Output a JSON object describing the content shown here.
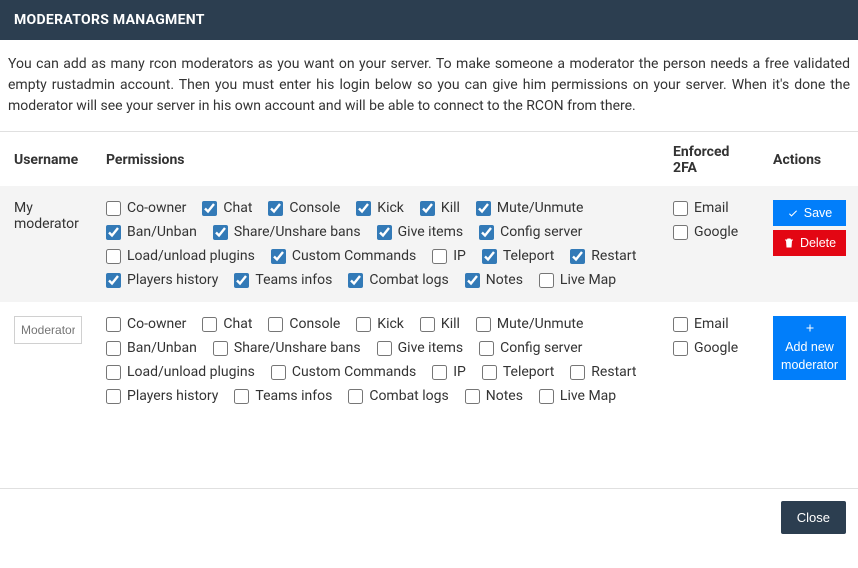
{
  "header": {
    "title": "MODERATORS MANAGMENT"
  },
  "description": "You can add as many rcon moderators as you want on your server. To make someone a moderator the person needs a free validated empty rustadmin account. Then you must enter his login below so you can give him permissions on your server. When it's done the moderator will see your server in his own account and will be able to connect to the RCON from there.",
  "columns": {
    "username": "Username",
    "permissions": "Permissions",
    "enforced": "Enforced 2FA",
    "actions": "Actions"
  },
  "permissions_list": [
    "Co-owner",
    "Chat",
    "Console",
    "Kick",
    "Kill",
    "Mute/Unmute",
    "Ban/Unban",
    "Share/Unshare bans",
    "Give items",
    "Config server",
    "Load/unload plugins",
    "Custom Commands",
    "IP",
    "Teleport",
    "Restart",
    "Players history",
    "Teams infos",
    "Combat logs",
    "Notes",
    "Live Map"
  ],
  "mfa_list": [
    "Email",
    "Google"
  ],
  "rows": [
    {
      "username": "My moderator",
      "checked": {
        "Co-owner": false,
        "Chat": true,
        "Console": true,
        "Kick": true,
        "Kill": true,
        "Mute/Unmute": true,
        "Ban/Unban": true,
        "Share/Unshare bans": true,
        "Give items": true,
        "Config server": true,
        "Load/unload plugins": false,
        "Custom Commands": true,
        "IP": false,
        "Teleport": true,
        "Restart": true,
        "Players history": true,
        "Teams infos": true,
        "Combat logs": true,
        "Notes": true,
        "Live Map": false
      },
      "mfa": {
        "Email": false,
        "Google": false
      }
    }
  ],
  "new_moderator_placeholder": "Moderator",
  "buttons": {
    "save": "Save",
    "delete": "Delete",
    "add": "Add new moderator",
    "close": "Close"
  }
}
